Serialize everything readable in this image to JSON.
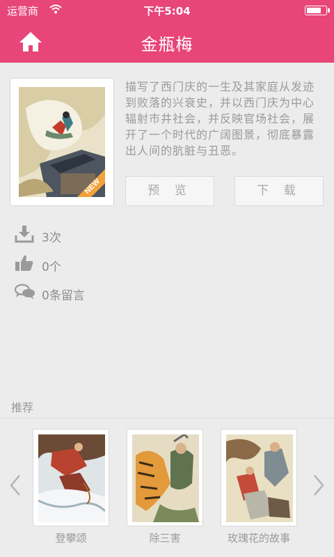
{
  "status_bar": {
    "carrier": "运营商",
    "time": "下午5:04",
    "battery_level": 0.85
  },
  "header": {
    "title": "金瓶梅",
    "home_icon": "home-icon"
  },
  "book": {
    "badge": "NEW",
    "description": "描写了西门庆的一生及其家庭从发迹到败落的兴衰史，并以西门庆为中心辐射市井社会，并反映官场社会，展开了一个时代的广阔图景，彻底暴露出人间的肮脏与丑恶。"
  },
  "actions": {
    "preview_label": "预 览",
    "download_label": "下 载"
  },
  "stats": {
    "downloads": "3次",
    "likes": "0个",
    "comments": "0条留言"
  },
  "recommend": {
    "label": "推荐",
    "items": [
      {
        "title": "登攀颂"
      },
      {
        "title": "除三害"
      },
      {
        "title": "玫瑰花的故事"
      }
    ]
  },
  "colors": {
    "accent": "#e8457a",
    "badge": "#f2a23a"
  }
}
